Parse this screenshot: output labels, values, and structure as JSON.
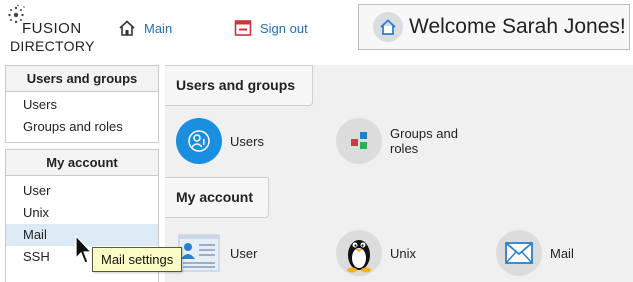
{
  "logo": {
    "line1": "FUSION",
    "line2": "DIRECTORY",
    "icon": "fusion-logo"
  },
  "header": {
    "nav": [
      {
        "label": "Main",
        "icon": "home-icon"
      },
      {
        "label": "Sign out",
        "icon": "sign-out-icon"
      }
    ],
    "welcome": "Welcome Sarah Jones!"
  },
  "sidebar": {
    "groups": [
      {
        "title": "Users and groups",
        "items": [
          "Users",
          "Groups and roles"
        ]
      },
      {
        "title": "My account",
        "items": [
          "User",
          "Unix",
          "Mail",
          "SSH"
        ],
        "highlighted": "Mail"
      }
    ]
  },
  "main": {
    "sections": [
      {
        "title": "Users and groups",
        "tiles": [
          {
            "label": "Users",
            "icon": "users-icon"
          },
          {
            "label": "Groups and roles",
            "icon": "groups-roles-icon"
          }
        ]
      },
      {
        "title": "My account",
        "tiles": [
          {
            "label": "User",
            "icon": "user-card-icon"
          },
          {
            "label": "Unix",
            "icon": "penguin-icon"
          },
          {
            "label": "Mail",
            "icon": "mail-envelope-icon"
          }
        ]
      }
    ]
  },
  "tooltip": "Mail settings",
  "colors": {
    "link": "#1f6fb2",
    "highlight": "#dceaf6",
    "tooltip_bg": "#fcfcc6",
    "content_bg": "#f0f0f0"
  }
}
